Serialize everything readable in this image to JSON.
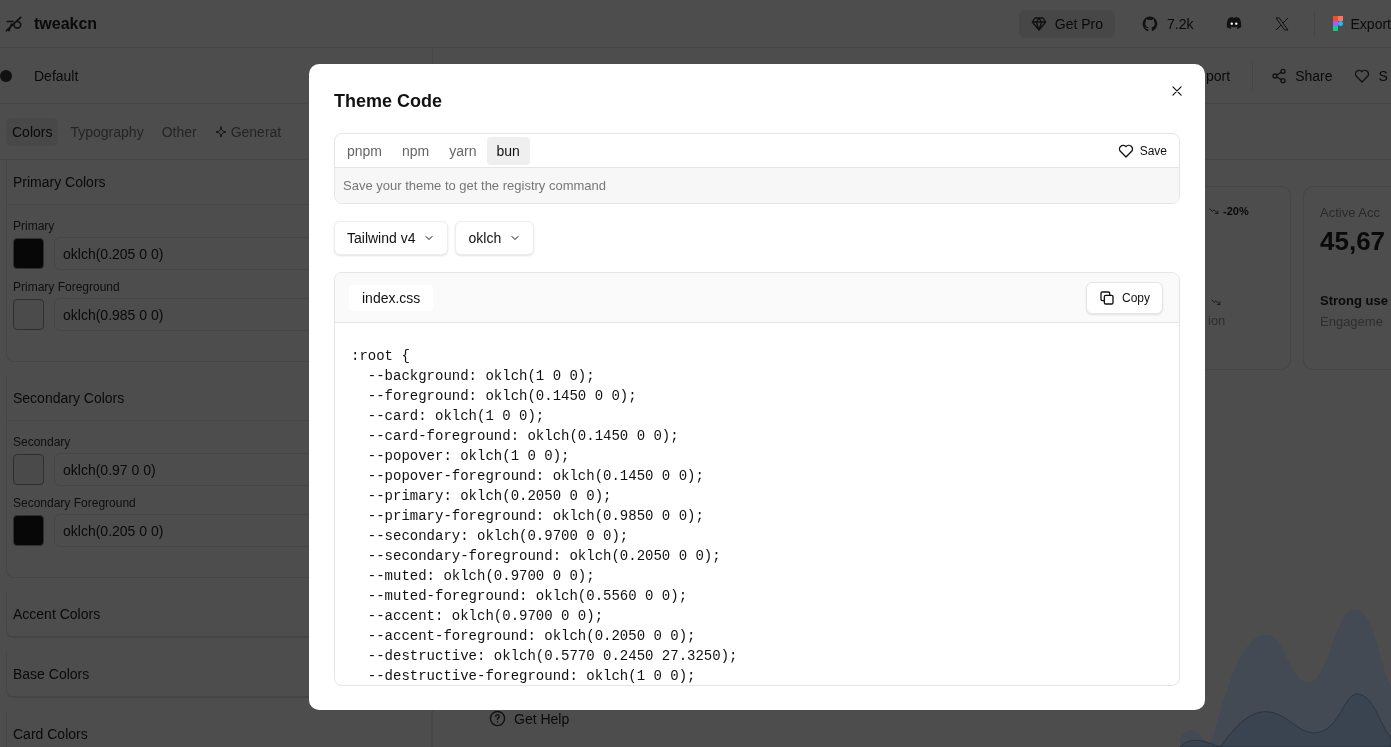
{
  "header": {
    "logo": "tweakcn",
    "actions": [
      {
        "kind": "pro",
        "label": "Get Pro"
      },
      {
        "kind": "github",
        "label": "7.2k"
      },
      {
        "kind": "discord"
      },
      {
        "kind": "x"
      },
      {
        "kind": "export",
        "label": "Export"
      }
    ]
  },
  "sidebar": {
    "theme_select": "Default",
    "tabs": [
      {
        "label": "Colors",
        "selected": true
      },
      {
        "label": "Typography",
        "selected": false
      },
      {
        "label": "Other",
        "selected": false
      },
      {
        "label": "Generat",
        "selected": false,
        "kind": "sparkle"
      }
    ],
    "sections": [
      {
        "title": "Primary Colors",
        "expanded": true,
        "items": [
          {
            "label": "Primary",
            "value": "oklch(0.205 0 0)",
            "color": "#070707"
          },
          {
            "label": "Primary Foreground",
            "value": "oklch(0.985 0 0)",
            "color": "#4b4b4b"
          }
        ]
      },
      {
        "title": "Secondary Colors",
        "expanded": true,
        "items": [
          {
            "label": "Secondary",
            "value": "oklch(0.97 0 0)",
            "color": "#4a4a4a"
          },
          {
            "label": "Secondary Foreground",
            "value": "oklch(0.205 0 0)",
            "color": "#070707"
          }
        ]
      },
      {
        "title": "Accent Colors",
        "expanded": false
      },
      {
        "title": "Base Colors",
        "expanded": false
      },
      {
        "title": "Card Colors",
        "expanded": false
      }
    ]
  },
  "toolbar": [
    {
      "kind": "import",
      "label": "port"
    },
    {
      "kind": "share",
      "label": "Share"
    },
    {
      "kind": "save",
      "label": "S"
    }
  ],
  "stats": [
    {
      "kind": "trend",
      "badge": "-20%",
      "footnote": "ion"
    },
    {
      "kind": "metric",
      "title": "Active Acc",
      "value": "45,67",
      "headline": "Strong use",
      "note": "Engageme"
    }
  ],
  "menu": [
    {
      "label": "Get Help"
    }
  ],
  "dialog": {
    "title": "Theme Code",
    "tabs": [
      {
        "label": "pnpm",
        "selected": false
      },
      {
        "label": "npm",
        "selected": false
      },
      {
        "label": "yarn",
        "selected": false
      },
      {
        "label": "bun",
        "selected": true
      }
    ],
    "save_button": "Save",
    "registry_hint": "Save your theme to get the registry command",
    "selects": [
      "Tailwind v4",
      "oklch"
    ],
    "file_tab": "index.css",
    "copy_button": "Copy",
    "code": [
      ":root {",
      "  --background: oklch(1 0 0);",
      "  --foreground: oklch(0.1450 0 0);",
      "  --card: oklch(1 0 0);",
      "  --card-foreground: oklch(0.1450 0 0);",
      "  --popover: oklch(1 0 0);",
      "  --popover-foreground: oklch(0.1450 0 0);",
      "  --primary: oklch(0.2050 0 0);",
      "  --primary-foreground: oklch(0.9850 0 0);",
      "  --secondary: oklch(0.9700 0 0);",
      "  --secondary-foreground: oklch(0.2050 0 0);",
      "  --muted: oklch(0.9700 0 0);",
      "  --muted-foreground: oklch(0.5560 0 0);",
      "  --accent: oklch(0.9700 0 0);",
      "  --accent-foreground: oklch(0.2050 0 0);",
      "  --destructive: oklch(0.5770 0.2450 27.3250);",
      "  --destructive-foreground: oklch(1 0 0);"
    ]
  }
}
